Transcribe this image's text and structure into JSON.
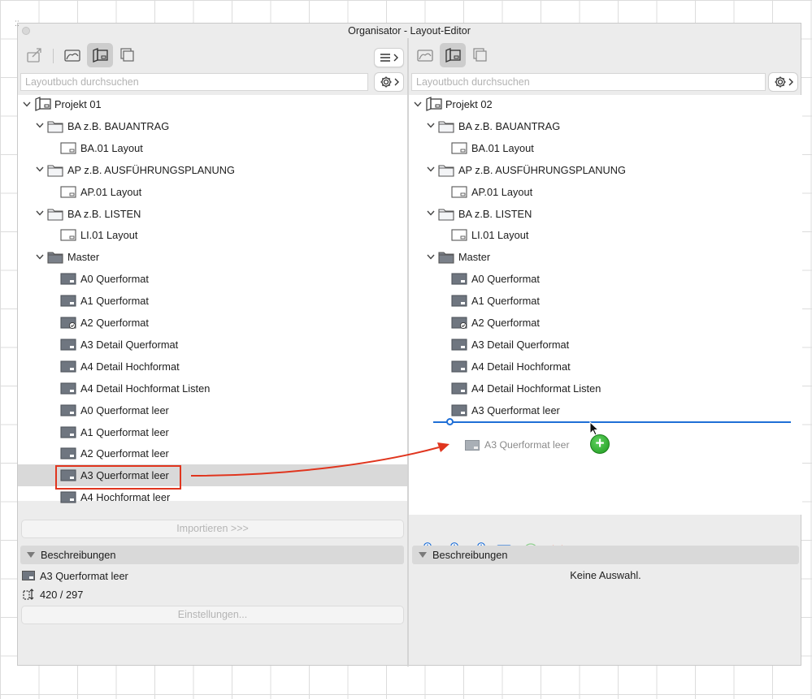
{
  "window": {
    "title": "Organisator - Layout-Editor"
  },
  "left": {
    "search_placeholder": "Layoutbuch durchsuchen",
    "tree": [
      {
        "label": "Projekt 01",
        "level": 0,
        "type": "book",
        "expanded": true
      },
      {
        "label": "BA z.B. BAUANTRAG",
        "level": 1,
        "type": "folder",
        "expanded": true
      },
      {
        "label": "BA.01 Layout",
        "level": 2,
        "type": "layout"
      },
      {
        "label": "AP z.B. AUSFÜHRUNGSPLANUNG",
        "level": 1,
        "type": "folder",
        "expanded": true
      },
      {
        "label": "AP.01 Layout",
        "level": 2,
        "type": "layout"
      },
      {
        "label": "BA z.B. LISTEN",
        "level": 1,
        "type": "folder",
        "expanded": true
      },
      {
        "label": "LI.01 Layout",
        "level": 2,
        "type": "layout"
      },
      {
        "label": "Master",
        "level": 1,
        "type": "folder-dark",
        "expanded": true
      },
      {
        "label": "A0 Querformat",
        "level": 2,
        "type": "master"
      },
      {
        "label": "A1 Querformat",
        "level": 2,
        "type": "master"
      },
      {
        "label": "A2 Querformat",
        "level": 2,
        "type": "master-check"
      },
      {
        "label": "A3 Detail Querformat",
        "level": 2,
        "type": "master"
      },
      {
        "label": "A4 Detail Hochformat",
        "level": 2,
        "type": "master"
      },
      {
        "label": "A4 Detail Hochformat Listen",
        "level": 2,
        "type": "master"
      },
      {
        "label": "A0 Querformat leer",
        "level": 2,
        "type": "master"
      },
      {
        "label": "A1 Querformat leer",
        "level": 2,
        "type": "master"
      },
      {
        "label": "A2 Querformat leer",
        "level": 2,
        "type": "master"
      },
      {
        "label": "A3 Querformat leer",
        "level": 2,
        "type": "master",
        "selected": true
      },
      {
        "label": "A4 Hochformat leer",
        "level": 2,
        "type": "master"
      }
    ],
    "import_label": "Importieren >>>",
    "descriptions_label": "Beschreibungen",
    "info_name": "A3 Querformat leer",
    "info_size": "420 / 297",
    "settings_label": "Einstellungen..."
  },
  "right": {
    "search_placeholder": "Layoutbuch durchsuchen",
    "tree": [
      {
        "label": "Projekt 02",
        "level": 0,
        "type": "book",
        "expanded": true
      },
      {
        "label": "BA z.B. BAUANTRAG",
        "level": 1,
        "type": "folder",
        "expanded": true
      },
      {
        "label": "BA.01 Layout",
        "level": 2,
        "type": "layout"
      },
      {
        "label": "AP z.B. AUSFÜHRUNGSPLANUNG",
        "level": 1,
        "type": "folder",
        "expanded": true
      },
      {
        "label": "AP.01 Layout",
        "level": 2,
        "type": "layout"
      },
      {
        "label": "BA z.B. LISTEN",
        "level": 1,
        "type": "folder",
        "expanded": true
      },
      {
        "label": "LI.01 Layout",
        "level": 2,
        "type": "layout"
      },
      {
        "label": "Master",
        "level": 1,
        "type": "folder-dark",
        "expanded": true
      },
      {
        "label": "A0 Querformat",
        "level": 2,
        "type": "master"
      },
      {
        "label": "A1 Querformat",
        "level": 2,
        "type": "master"
      },
      {
        "label": "A2 Querformat",
        "level": 2,
        "type": "master-check"
      },
      {
        "label": "A3 Detail Querformat",
        "level": 2,
        "type": "master"
      },
      {
        "label": "A4 Detail Hochformat",
        "level": 2,
        "type": "master"
      },
      {
        "label": "A4 Detail Hochformat Listen",
        "level": 2,
        "type": "master"
      },
      {
        "label": "A3 Querformat leer",
        "level": 2,
        "type": "master"
      }
    ],
    "drag_ghost_label": "A3 Querformat leer",
    "descriptions_label": "Beschreibungen",
    "no_selection": "Keine Auswahl."
  },
  "colors": {
    "accent_blue": "#1f6fd6",
    "annotation_red": "#e0351e",
    "add_green": "#2aa52a"
  }
}
